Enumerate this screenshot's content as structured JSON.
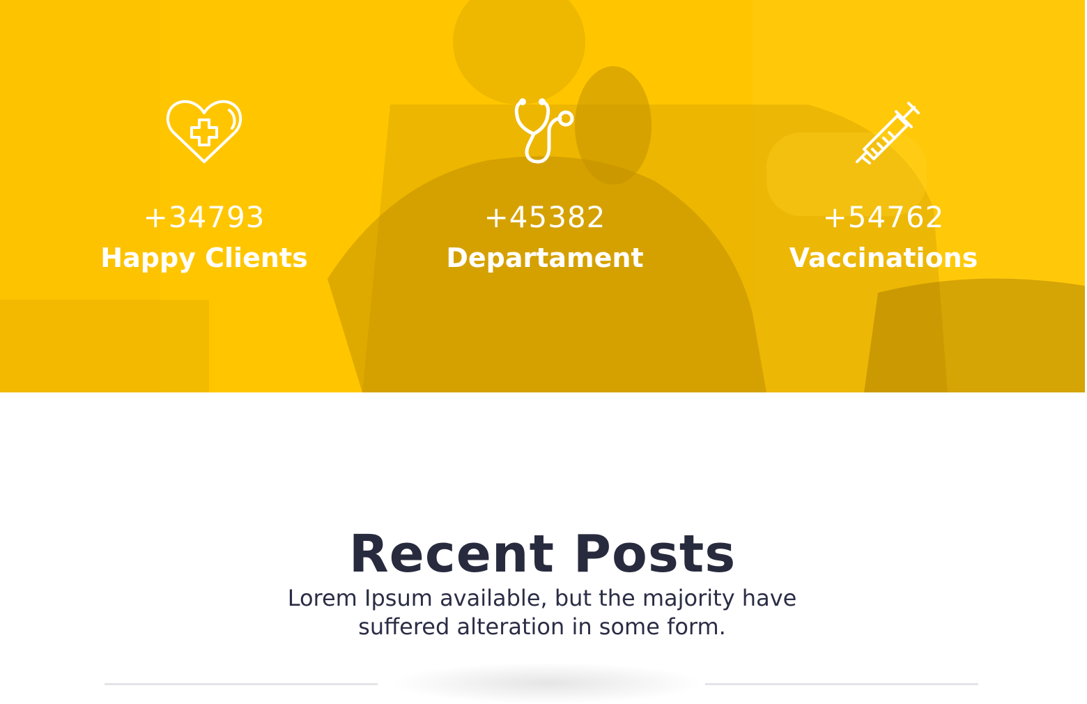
{
  "stats": [
    {
      "icon": "heart-plus-icon",
      "number": "+34793",
      "label": "Happy Clients"
    },
    {
      "icon": "stethoscope-icon",
      "number": "+45382",
      "label": "Departament"
    },
    {
      "icon": "syringe-icon",
      "number": "+54762",
      "label": "Vaccinations"
    }
  ],
  "recent_posts": {
    "title": "Recent Posts",
    "subtitle": "Lorem Ipsum available, but the majority have suffered alteration in some form."
  },
  "colors": {
    "accent": "#ffc600",
    "heading": "#282a3e",
    "stat_text": "#ffffff"
  }
}
